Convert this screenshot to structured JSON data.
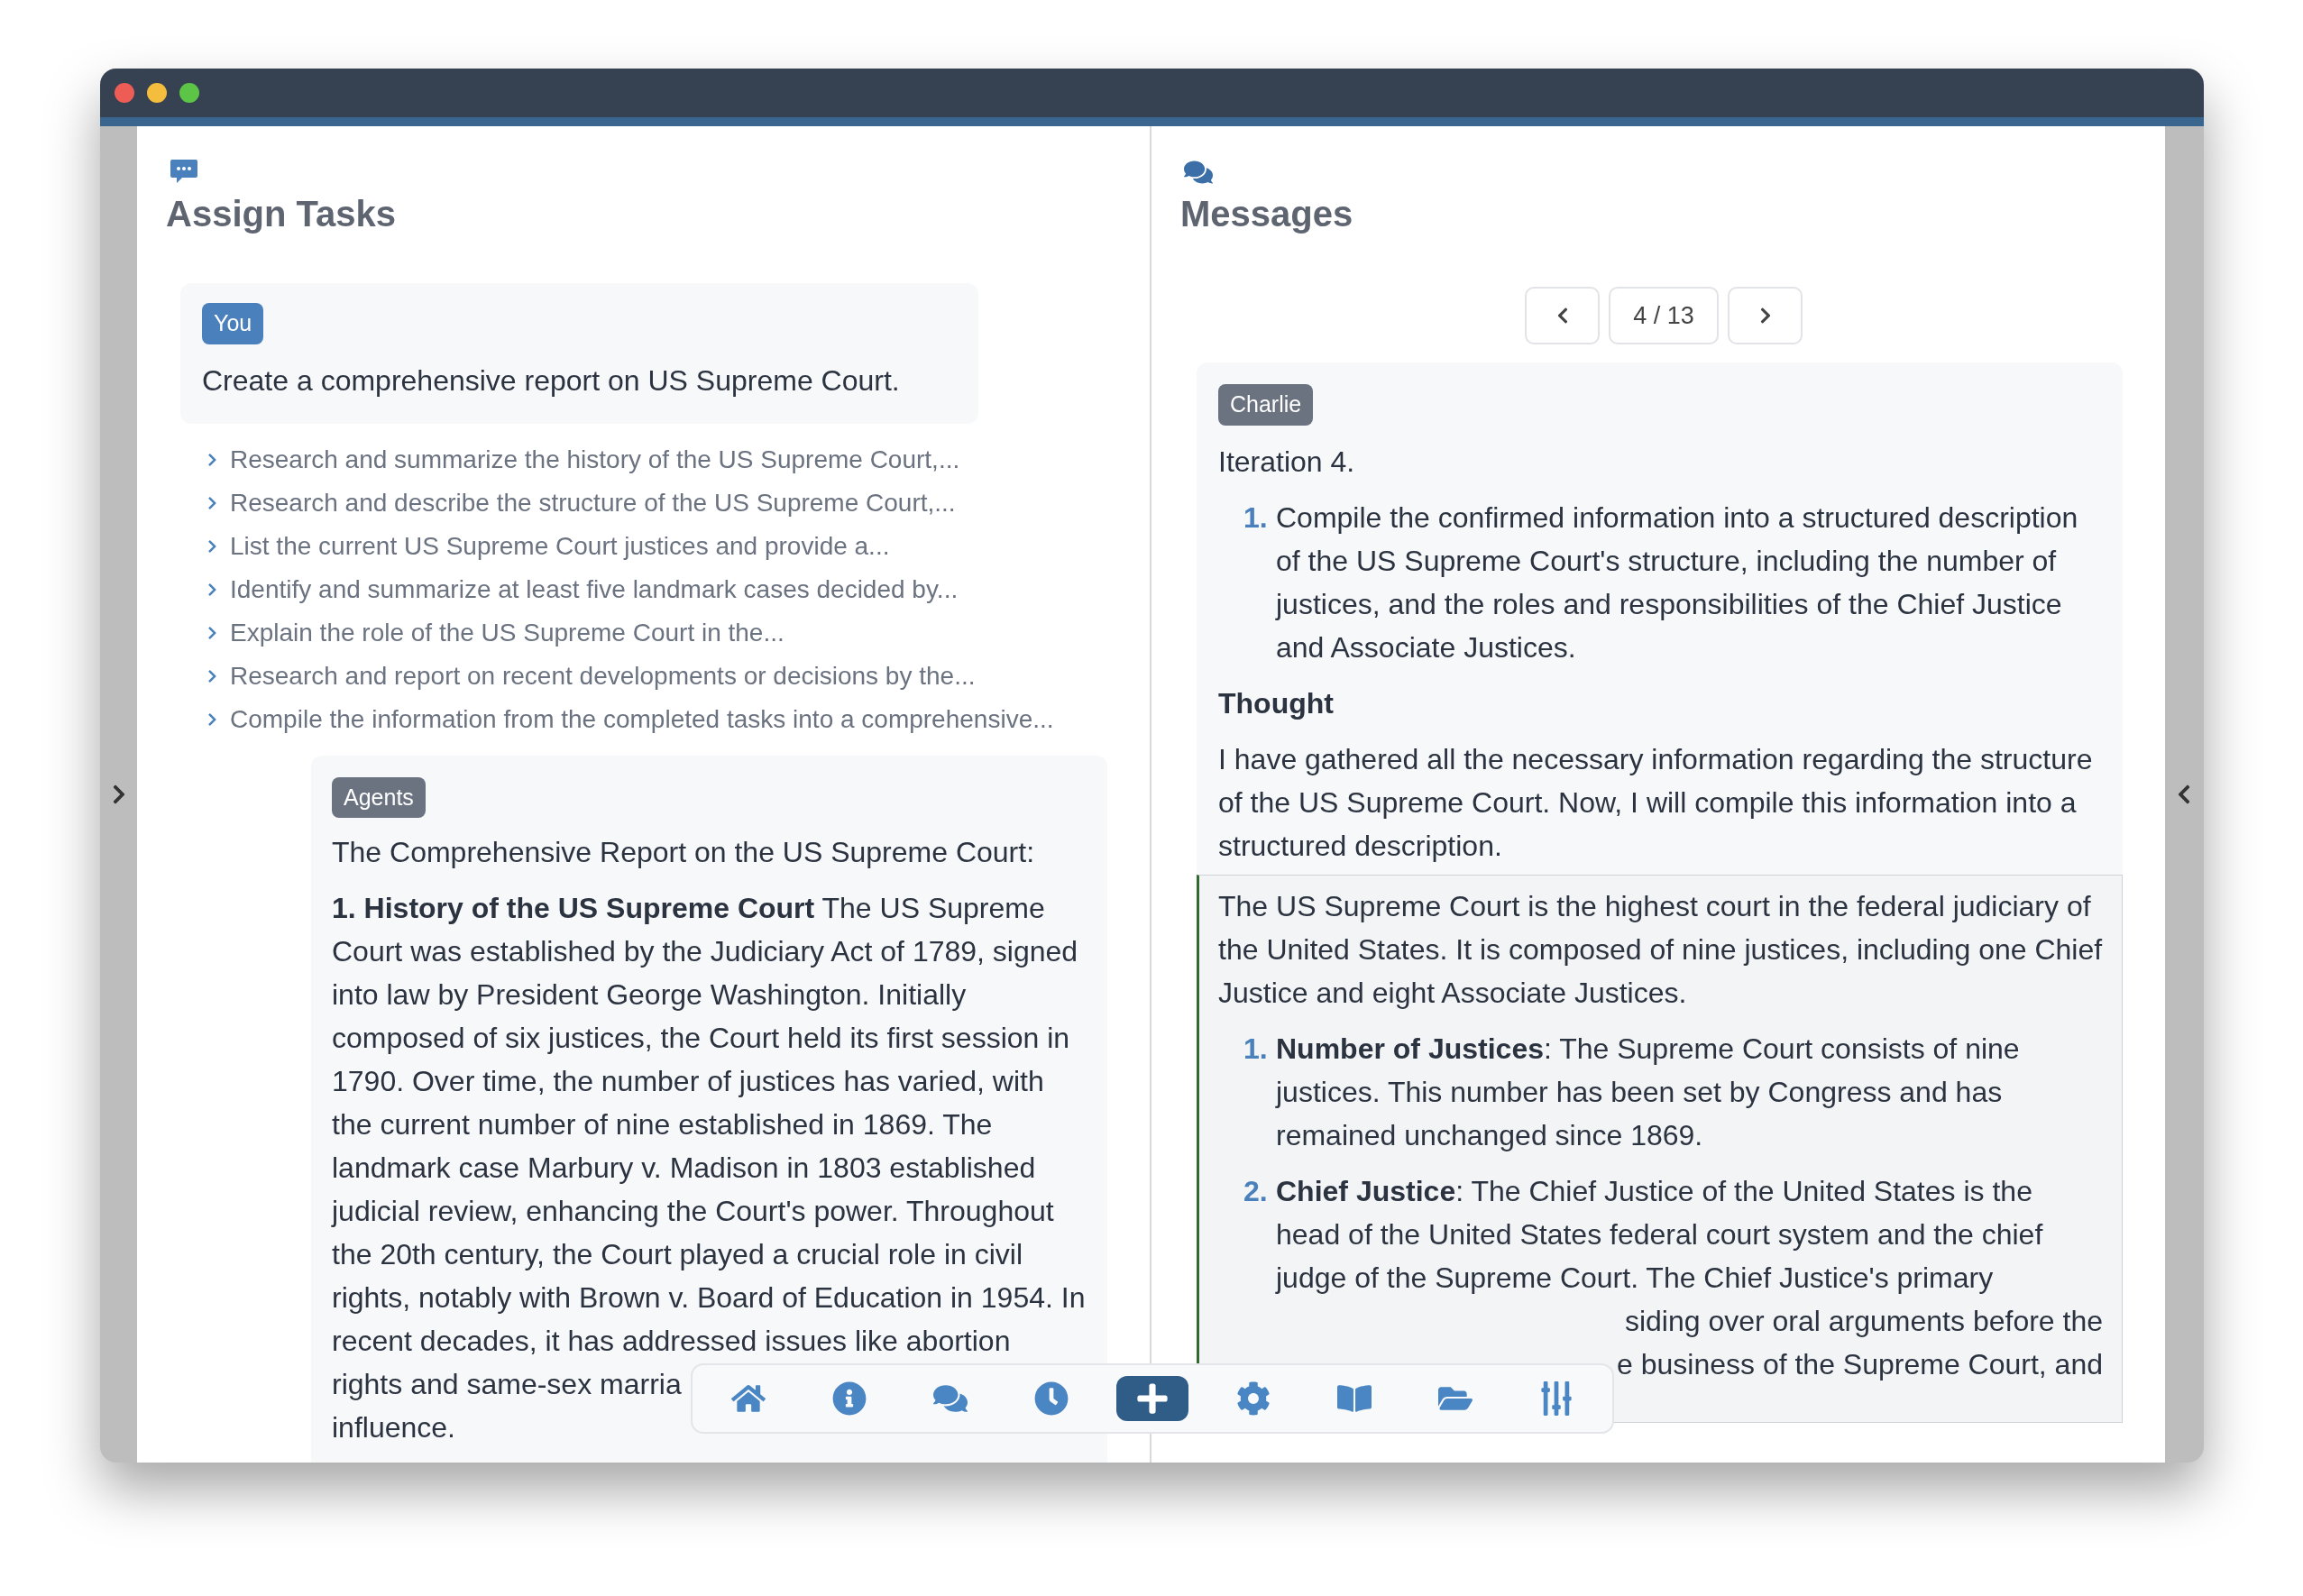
{
  "left_panel": {
    "title": "Assign Tasks",
    "user_message": {
      "badge": "You",
      "text": "Create a comprehensive report on US Supreme Court."
    },
    "tasks": [
      {
        "text": "Research and summarize the history of the US Supreme Court,...",
        "expanded": false
      },
      {
        "text": "Research and describe the structure of the US Supreme Court,...",
        "expanded": false
      },
      {
        "text": "List the current US Supreme Court justices and provide a...",
        "expanded": false
      },
      {
        "text": "Identify and summarize at least five landmark cases decided by...",
        "expanded": false
      },
      {
        "text": "Explain the role of the US Supreme Court in the...",
        "expanded": false
      },
      {
        "text": "Research and report on recent developments or decisions by the...",
        "expanded": false
      },
      {
        "text": "Compile the information from the completed tasks into a comprehensive...",
        "expanded": false
      }
    ],
    "agents_message": {
      "badge": "Agents",
      "heading": "The Comprehensive Report on the US Supreme Court:",
      "paragraphs": [
        "**1. History of the US Supreme Court** The US Supreme Court was established by the Judiciary Act of 1789, signed into law by President George Washington. Initially composed of six justices, the Court held its first session in 1790. Over time, the number of justices has varied, with the current number of nine established in 1869. The landmark case Marbury v. Madison in 1803 established judicial review, enhancing the Court's power. Throughout the 20th century, the Court played a crucial role in civil rights, notably with Brown v. Board of Education in 1954. In recent decades, it has addressed issues like abortion"
      ],
      "visible_lines": [
        "rights and same-sex marria",
        "influence."
      ]
    }
  },
  "right_panel": {
    "title": "Messages",
    "pager": {
      "label": "4 / 13"
    },
    "message": {
      "badge": "Charlie",
      "intro": "Iteration 4.",
      "steps": [
        {
          "number": "1.",
          "text": "Compile the confirmed information into a structured description of the US Supreme Court's structure, including the number of justices, and the roles and responsibilities of the Chief Justice and Associate Justices."
        }
      ],
      "thought_heading": "Thought",
      "thought": "I have gathered all the necessary information regarding the structure of the US Supreme Court. Now, I will compile this information into a structured description.",
      "quote": {
        "intro": "The US Supreme Court is the highest court in the federal judiciary of the United States. It is composed of nine justices, including one Chief Justice and eight Associate Justices.",
        "items": [
          {
            "number": "1.",
            "text": "**Number of Justices**: The Supreme Court consists of nine justices. This number has been set by Congress and has remained unchanged since 1869."
          },
          {
            "number": "2.",
            "text": "**Chief Justice**: The Chief Justice of the United States is the head of the United States federal court system and the chief judge of the Supreme Court. The Chief Justice's primary",
            "visible_lines": [
              "siding over oral arguments before the",
              "e business of the Supreme Court, and"
            ]
          }
        ]
      }
    }
  },
  "toolbar": [
    {
      "kind": "home",
      "selected": false
    },
    {
      "kind": "info",
      "selected": false
    },
    {
      "kind": "chat",
      "selected": false
    },
    {
      "kind": "clock",
      "selected": false
    },
    {
      "kind": "add",
      "selected": true
    },
    {
      "kind": "settings",
      "selected": false
    },
    {
      "kind": "book",
      "selected": false
    },
    {
      "kind": "folder",
      "selected": false
    },
    {
      "kind": "sliders",
      "selected": false
    }
  ]
}
